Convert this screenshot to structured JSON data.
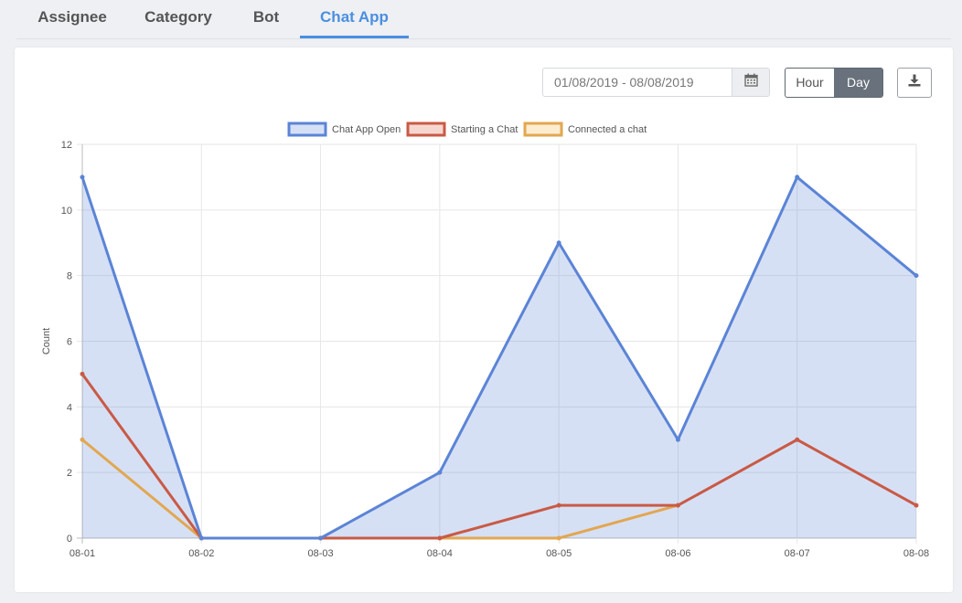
{
  "tabs": [
    {
      "label": "Assignee",
      "active": false
    },
    {
      "label": "Category",
      "active": false
    },
    {
      "label": "Bot",
      "active": false
    },
    {
      "label": "Chat App",
      "active": true
    }
  ],
  "toolbar": {
    "date_range": "01/08/2019 - 08/08/2019",
    "calendar_icon": "calendar-icon",
    "granularity_options": [
      "Hour",
      "Day"
    ],
    "granularity_selected": "Day",
    "download_icon": "download-icon"
  },
  "colors": {
    "accent": "#4a8fe0",
    "chat_app_open": "#5b84d6",
    "starting_a_chat": "#c95a45",
    "connected_a_chat": "#e2a750"
  },
  "chart_data": {
    "type": "line",
    "categories": [
      "08-01",
      "08-02",
      "08-03",
      "08-04",
      "08-05",
      "08-06",
      "08-07",
      "08-08"
    ],
    "ylabel": "Count",
    "xlabel": "",
    "ylim": [
      0,
      12
    ],
    "yticks": [
      0,
      2,
      4,
      6,
      8,
      10,
      12
    ],
    "grid": true,
    "legend_position": "top-center",
    "series": [
      {
        "name": "Chat App Open",
        "values": [
          11,
          0,
          0,
          2,
          9,
          3,
          11,
          8
        ],
        "color": "#5b84d6",
        "fill": "rgba(91,132,214,0.25)",
        "filled": true
      },
      {
        "name": "Starting a Chat",
        "values": [
          5,
          0,
          0,
          0,
          1,
          1,
          3,
          1
        ],
        "color": "#c95a45",
        "fill": "rgba(230,140,120,0.35)",
        "filled": false
      },
      {
        "name": "Connected a chat",
        "values": [
          3,
          0,
          0,
          0,
          0,
          1,
          null,
          null
        ],
        "color": "#e2a750",
        "fill": "rgba(245,200,120,0.35)",
        "filled": false
      }
    ]
  }
}
